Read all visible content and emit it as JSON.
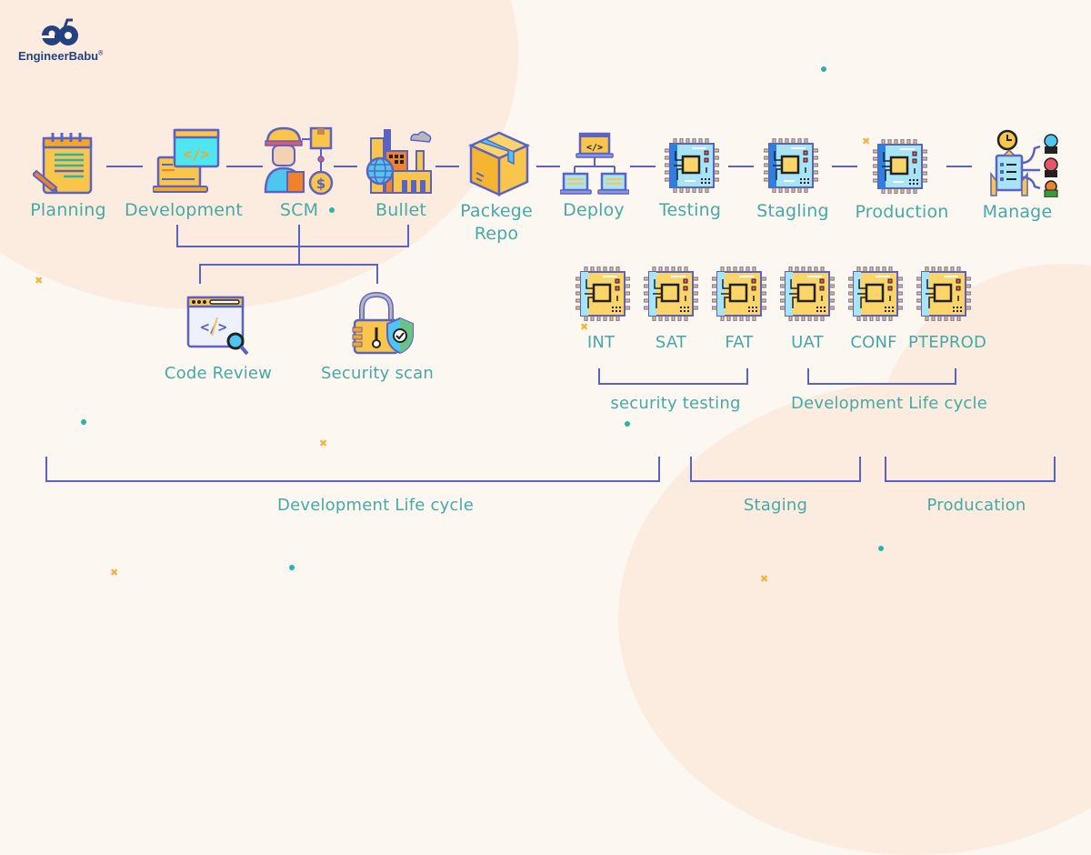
{
  "brand": {
    "name": "EngineerBabu",
    "mark": "®"
  },
  "colors": {
    "label": "#45aaa6",
    "connector": "#5a63c4",
    "background": "#fdf7f2",
    "accent_dot": "#2bb3ab",
    "accent_cross": "#f3b33d",
    "brand": "#23427f"
  },
  "pipeline": {
    "stages": [
      {
        "label": "Planning",
        "icon": "notepad-icon"
      },
      {
        "label": "Development",
        "icon": "laptop-code-icon"
      },
      {
        "label": "SCM",
        "icon": "worker-supply-chain-icon"
      },
      {
        "label": "Bullet",
        "icon": "factory-globe-icon"
      },
      {
        "label": "Packege\nRepo",
        "label_line1": "Packege",
        "label_line2": "Repo",
        "icon": "package-box-icon"
      },
      {
        "label": "Deploy",
        "icon": "network-deploy-icon"
      },
      {
        "label": "Testing",
        "icon": "chip-icon"
      },
      {
        "label": "Stagling",
        "icon": "chip-icon"
      },
      {
        "label": "Production",
        "icon": "chip-icon"
      },
      {
        "label": "Manage",
        "icon": "manage-team-icon"
      }
    ]
  },
  "checks": [
    {
      "label": "Code Review",
      "icon": "code-review-icon"
    },
    {
      "label": "Security scan",
      "icon": "security-lock-icon"
    }
  ],
  "environments": {
    "items": [
      "INT",
      "SAT",
      "FAT",
      "UAT",
      "CONF",
      "PTEPROD"
    ],
    "groups": [
      {
        "label": "security testing"
      },
      {
        "label": "Development Life cycle"
      }
    ]
  },
  "phases": [
    {
      "label": "Development Life cycle"
    },
    {
      "label": "Staging"
    },
    {
      "label": "Producation"
    }
  ]
}
